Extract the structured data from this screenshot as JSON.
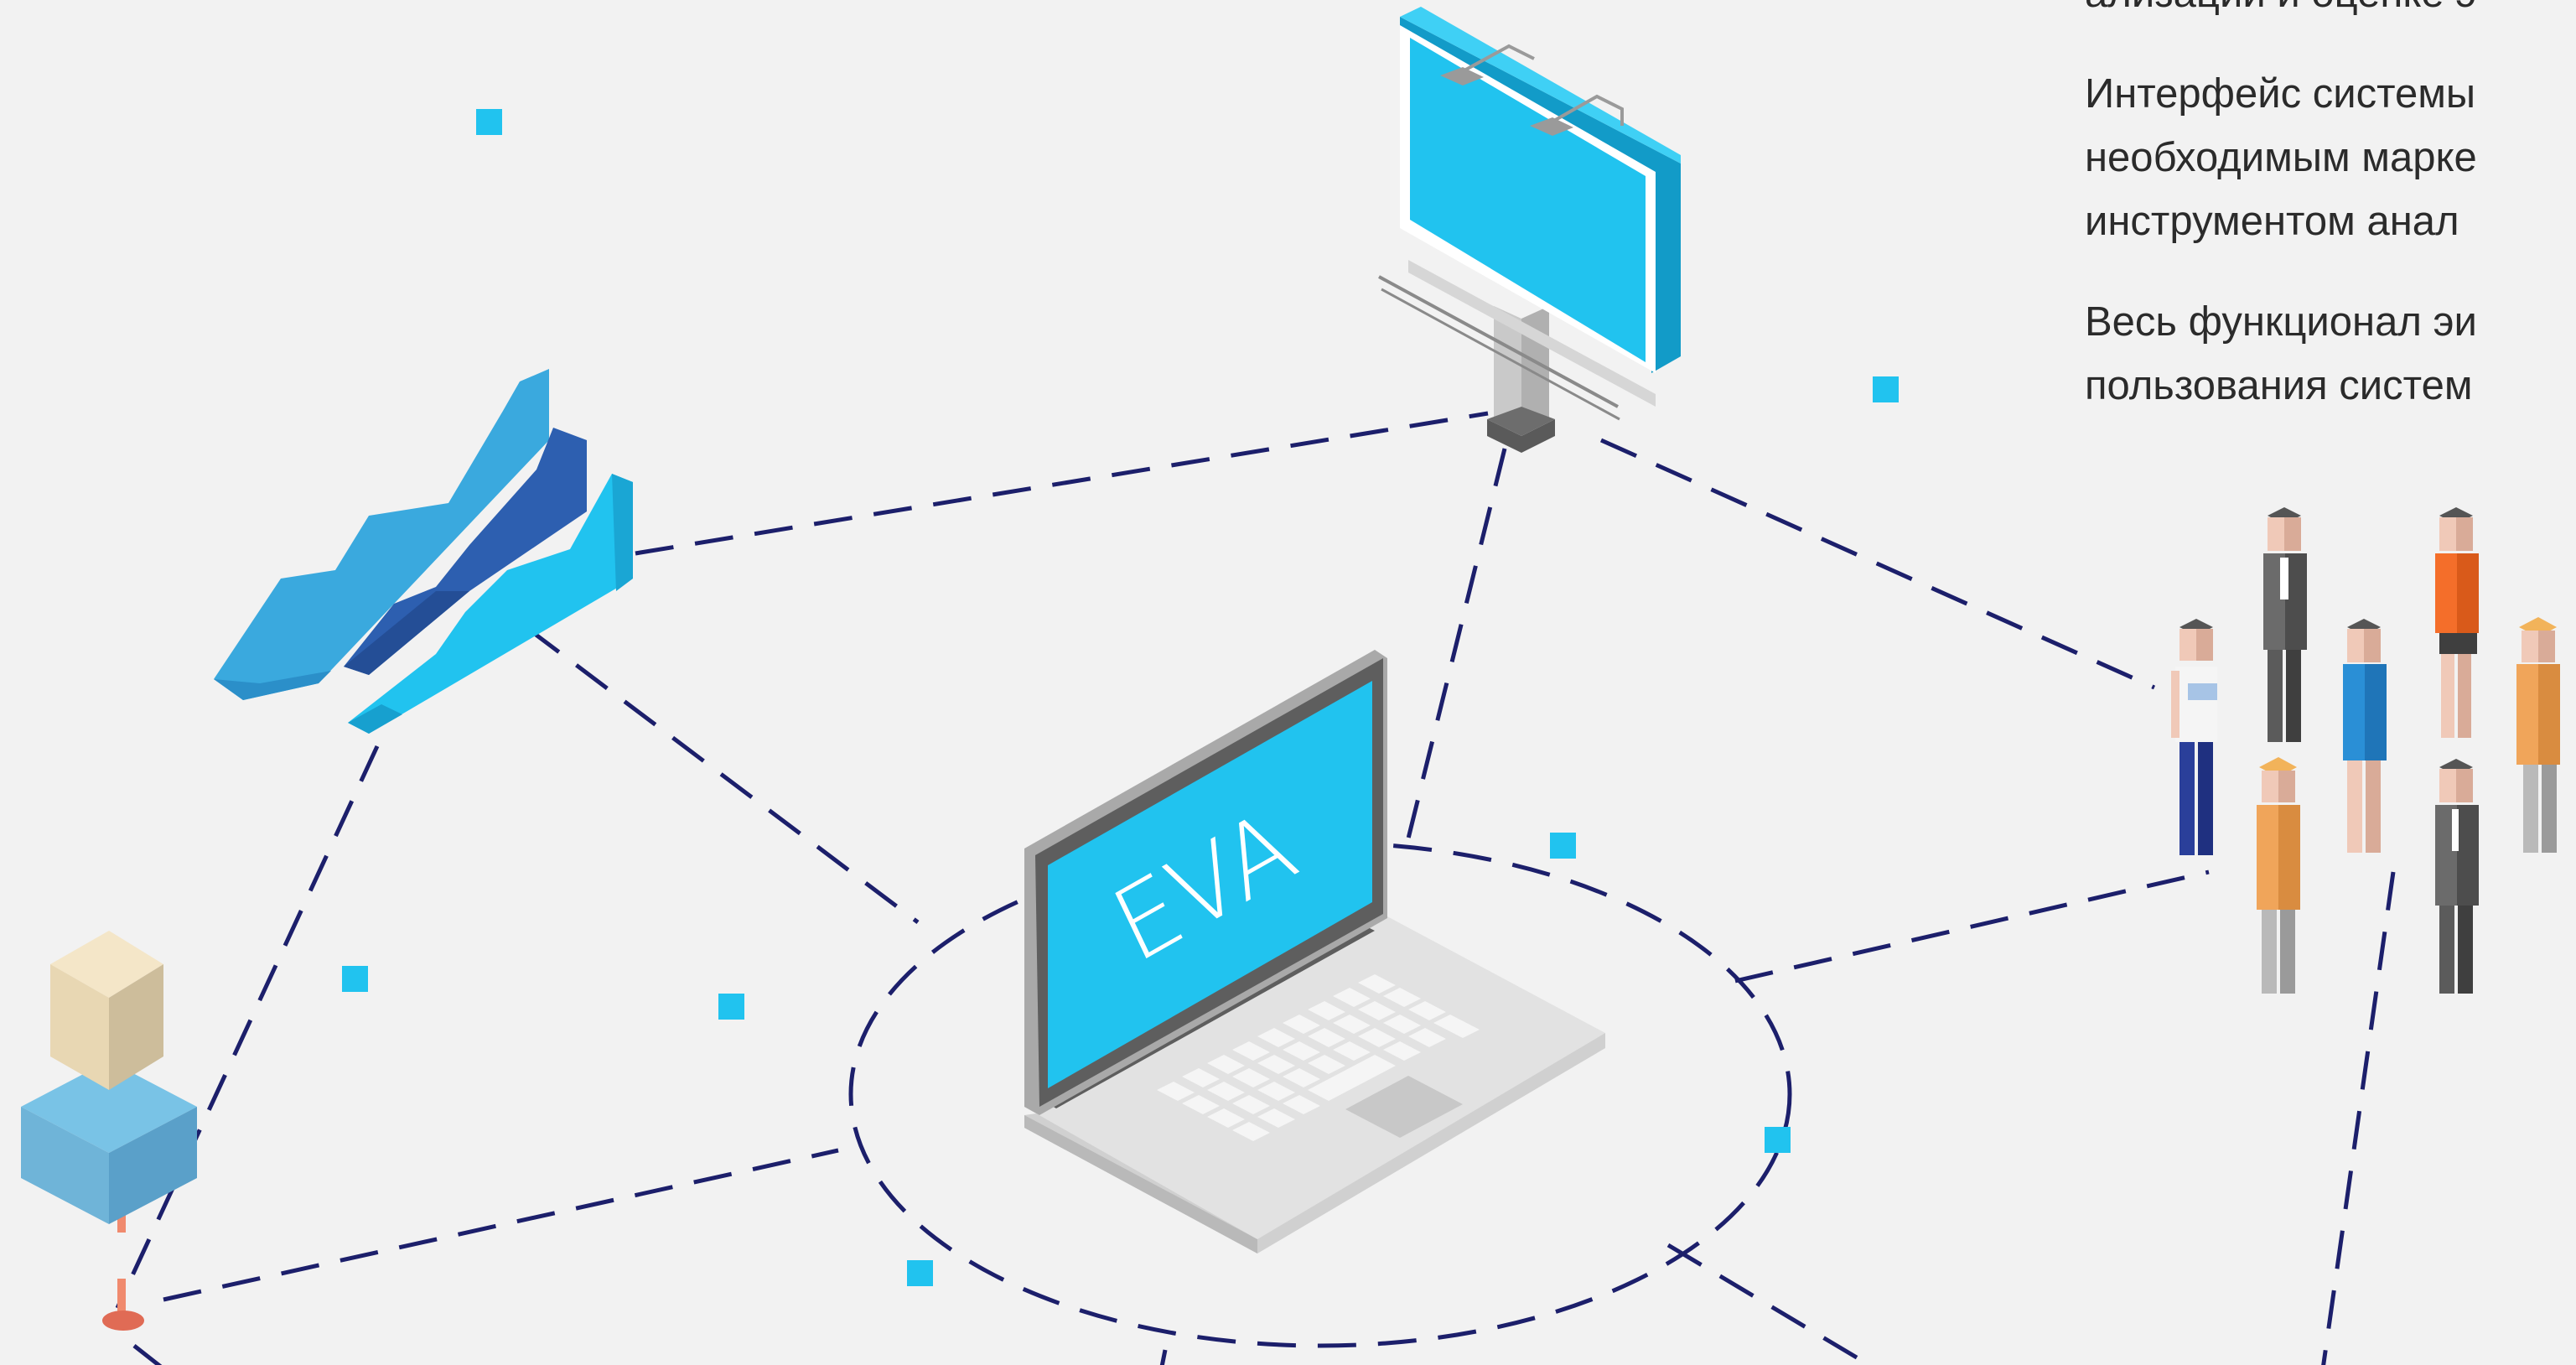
{
  "copy": {
    "p1": {
      "l1": "ализации и оценке э"
    },
    "p2": {
      "l1": "Интерфейс системы",
      "l2": "необходимым марке",
      "l3": "инструментом анал"
    },
    "p3": {
      "l1": "Весь функционал эи",
      "l2": "пользования систем"
    }
  },
  "laptop": {
    "screen_text": "EVA"
  },
  "colors": {
    "background": "#f2f2f2",
    "accent_cyan": "#21c3ef",
    "dash_navy": "#1c1f6b",
    "text": "#2b2b2b"
  }
}
